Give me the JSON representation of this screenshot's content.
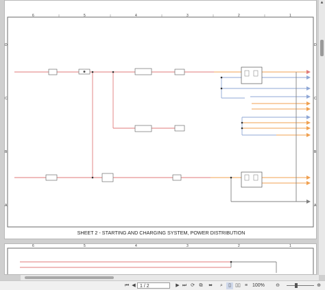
{
  "document": {
    "sheet_title": "SHEET 2 - STARTING AND CHARGING SYSTEM, POWER DISTRIBUTION",
    "column_labels": [
      "6",
      "5",
      "4",
      "3",
      "2",
      "1"
    ],
    "row_labels": [
      "D",
      "C",
      "B",
      "A"
    ]
  },
  "toolbar": {
    "page_value": "1 / 2",
    "zoom_label": "100%"
  },
  "colors": {
    "power_wire": "#e07a7a",
    "battery_wire": "#f0a050",
    "signal_wire": "#8fa7d6",
    "ground_wire": "#808080",
    "accent": "#2b6fd6"
  },
  "icons": [
    "prev-page-icon",
    "next-page-icon",
    "last-page-icon",
    "first-page-icon",
    "rotate-icon",
    "fit-page-icon",
    "fit-width-icon",
    "single-page-icon",
    "two-page-icon",
    "search-icon",
    "zoom-out-icon",
    "zoom-in-icon"
  ]
}
